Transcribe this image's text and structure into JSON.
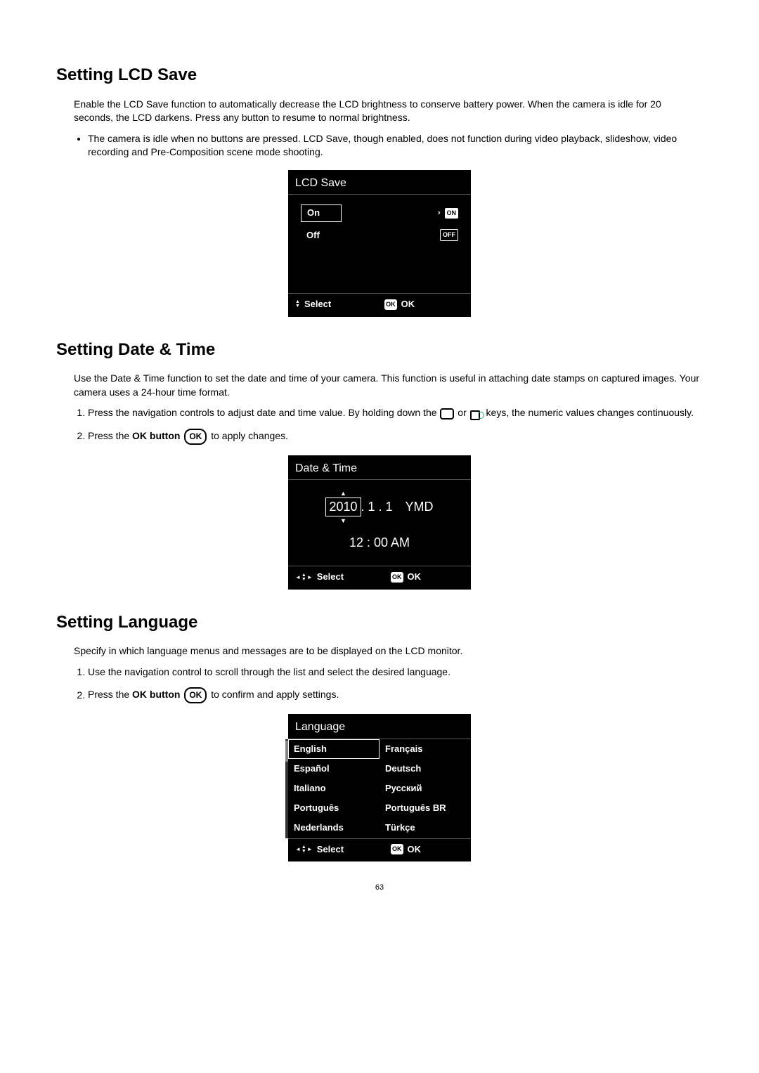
{
  "page_number": "63",
  "section1": {
    "heading": "Setting LCD Save",
    "intro": "Enable the LCD Save function to automatically decrease the LCD brightness to conserve battery power. When the camera is idle for 20 seconds, the LCD darkens. Press any button to resume to normal brightness.",
    "bullet": "The camera is idle when no buttons are pressed. LCD Save, though enabled, does not function during video playback, slideshow, video recording and Pre-Composition scene mode shooting.",
    "lcd": {
      "title": "LCD Save",
      "on_label": "On",
      "on_badge": "ON",
      "off_label": "Off",
      "off_badge": "OFF",
      "footer_select": "Select",
      "footer_ok": "OK"
    }
  },
  "section2": {
    "heading": "Setting Date & Time",
    "intro": "Use the Date & Time function to set the date and time of your camera. This function is useful in attaching date stamps on captured images. Your camera uses a 24-hour time format.",
    "step1a": "Press the navigation controls to adjust date and time value. By holding down the ",
    "step1b": " or ",
    "step1c": " keys, the numeric values changes continuously.",
    "step2a": "Press the ",
    "step2b": "OK button",
    "step2c": " to apply changes.",
    "ok_icon": "OK",
    "lcd": {
      "title": "Date & Time",
      "year": "2010",
      "rest_date": ".  1 .  1",
      "ymd": "YMD",
      "time": "12 : 00  AM",
      "footer_select": "Select",
      "footer_ok": "OK"
    }
  },
  "section3": {
    "heading": "Setting Language",
    "intro": "Specify in which language menus and messages are to be displayed on the LCD monitor.",
    "step1": "Use the navigation control to scroll through the list and select the desired language.",
    "step2a": "Press the ",
    "step2b": "OK button",
    "step2c": " to confirm and apply settings.",
    "ok_icon": "OK",
    "lcd": {
      "title": "Language",
      "col1": [
        "English",
        "Español",
        "Italiano",
        "Português",
        "Nederlands"
      ],
      "col2": [
        "Français",
        "Deutsch",
        "Русский",
        "Português BR",
        "Türkçe"
      ],
      "footer_select": "Select",
      "footer_ok": "OK"
    }
  }
}
